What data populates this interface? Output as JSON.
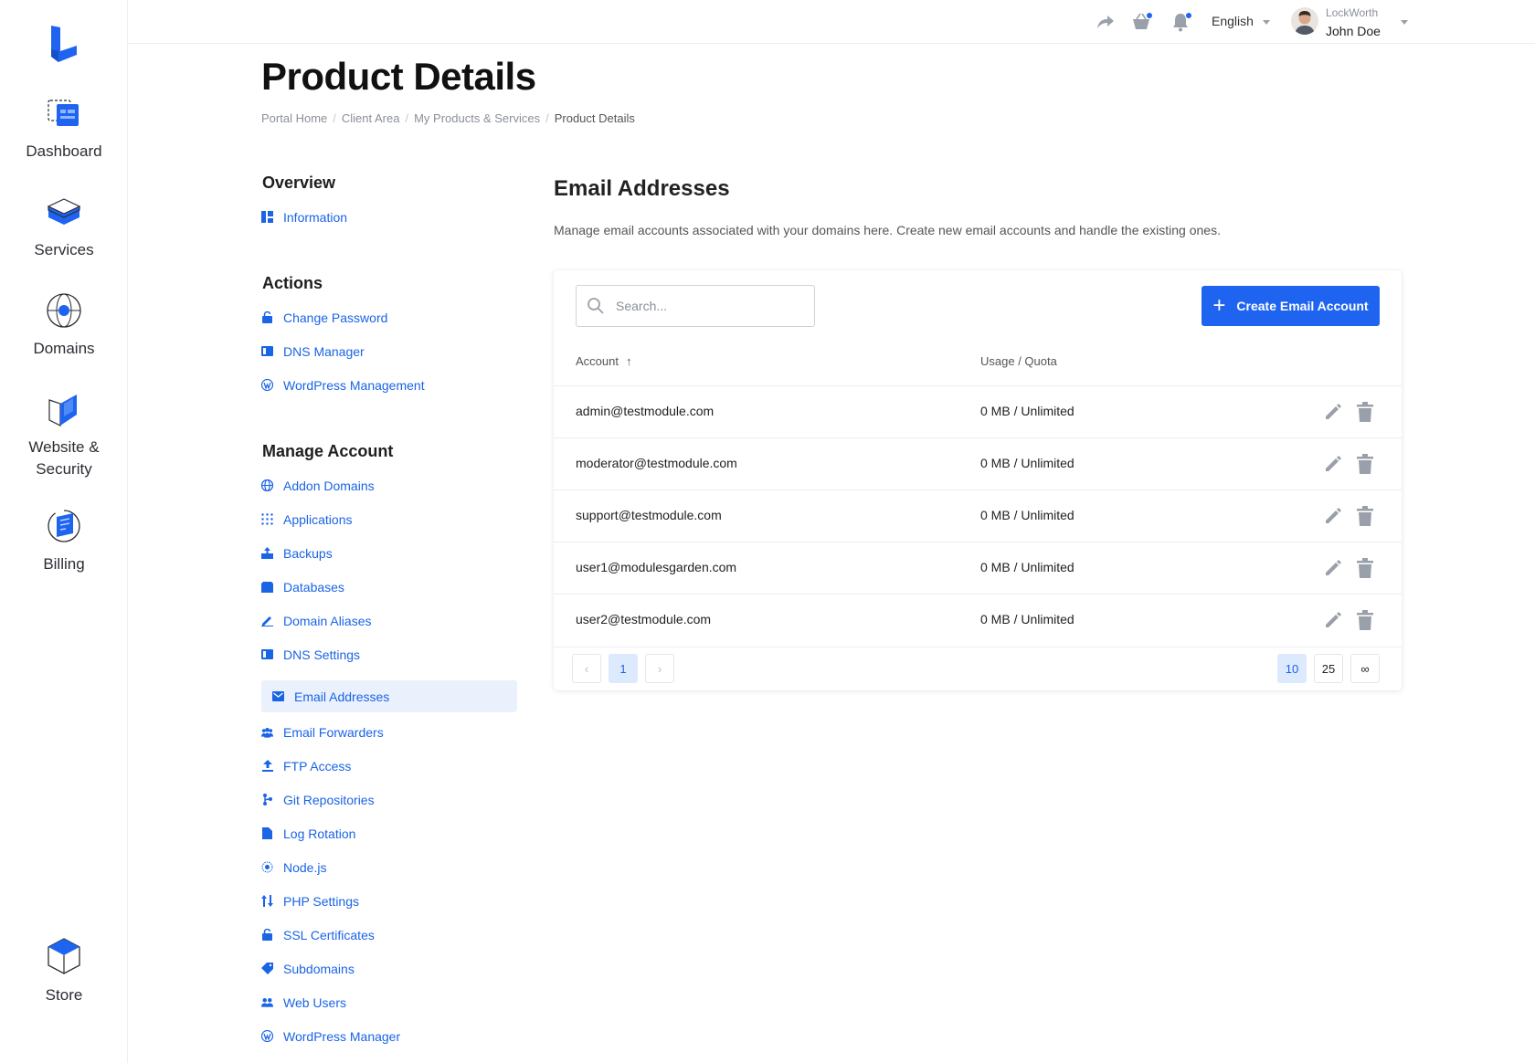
{
  "rail": {
    "items": [
      {
        "label": "Dashboard"
      },
      {
        "label": "Services"
      },
      {
        "label": "Domains"
      },
      {
        "label_line1": "Website &",
        "label_line2": "Security"
      },
      {
        "label": "Billing"
      },
      {
        "label": "Store"
      }
    ]
  },
  "topbar": {
    "language": "English",
    "company": "LockWorth",
    "user_name": "John Doe"
  },
  "page": {
    "title": "Product Details",
    "breadcrumb": [
      "Portal Home",
      "Client Area",
      "My Products & Services",
      "Product Details"
    ]
  },
  "sidenav": {
    "overview_heading": "Overview",
    "overview_items": [
      {
        "label": "Information",
        "icon": "dashboard-icon"
      }
    ],
    "actions_heading": "Actions",
    "actions_items": [
      {
        "label": "Change Password",
        "icon": "lock-icon"
      },
      {
        "label": "DNS Manager",
        "icon": "server-icon"
      },
      {
        "label": "WordPress Management",
        "icon": "wordpress-icon"
      }
    ],
    "manage_heading": "Manage Account",
    "manage_items": [
      {
        "label": "Addon Domains",
        "icon": "globe-icon"
      },
      {
        "label": "Applications",
        "icon": "grid-icon"
      },
      {
        "label": "Backups",
        "icon": "backup-icon"
      },
      {
        "label": "Databases",
        "icon": "database-icon"
      },
      {
        "label": "Domain Aliases",
        "icon": "pencil-icon"
      },
      {
        "label": "DNS Settings",
        "icon": "server-icon"
      },
      {
        "label": "Email Addresses",
        "icon": "envelope-icon",
        "active": true
      },
      {
        "label": "Email Forwarders",
        "icon": "users-icon"
      },
      {
        "label": "FTP Access",
        "icon": "upload-icon"
      },
      {
        "label": "Git Repositories",
        "icon": "git-icon"
      },
      {
        "label": "Log Rotation",
        "icon": "file-icon"
      },
      {
        "label": "Node.js",
        "icon": "node-icon"
      },
      {
        "label": "PHP Settings",
        "icon": "sliders-icon"
      },
      {
        "label": "SSL Certificates",
        "icon": "lock-icon"
      },
      {
        "label": "Subdomains",
        "icon": "tag-icon"
      },
      {
        "label": "Web Users",
        "icon": "users-icon"
      },
      {
        "label": "WordPress Manager",
        "icon": "wordpress-icon"
      }
    ]
  },
  "main": {
    "title": "Email Addresses",
    "description": "Manage email accounts associated with your domains here. Create new email accounts and handle the existing ones.",
    "search_placeholder": "Search...",
    "create_label": "Create Email Account",
    "col_account": "Account",
    "col_usage": "Usage / Quota",
    "rows": [
      {
        "account": "admin@testmodule.com",
        "usage": "0 MB / Unlimited"
      },
      {
        "account": "moderator@testmodule.com",
        "usage": "0 MB / Unlimited"
      },
      {
        "account": "support@testmodule.com",
        "usage": "0 MB / Unlimited"
      },
      {
        "account": "user1@modulesgarden.com",
        "usage": "0 MB / Unlimited"
      },
      {
        "account": "user2@testmodule.com",
        "usage": "0 MB / Unlimited"
      }
    ],
    "pagination": {
      "prev": "‹",
      "page": "1",
      "next": "›",
      "sizes": [
        "10",
        "25",
        "∞"
      ]
    }
  },
  "colors": {
    "accent": "#1e64f0",
    "link": "#1a64e6",
    "active_bg": "#eaf1fd"
  }
}
